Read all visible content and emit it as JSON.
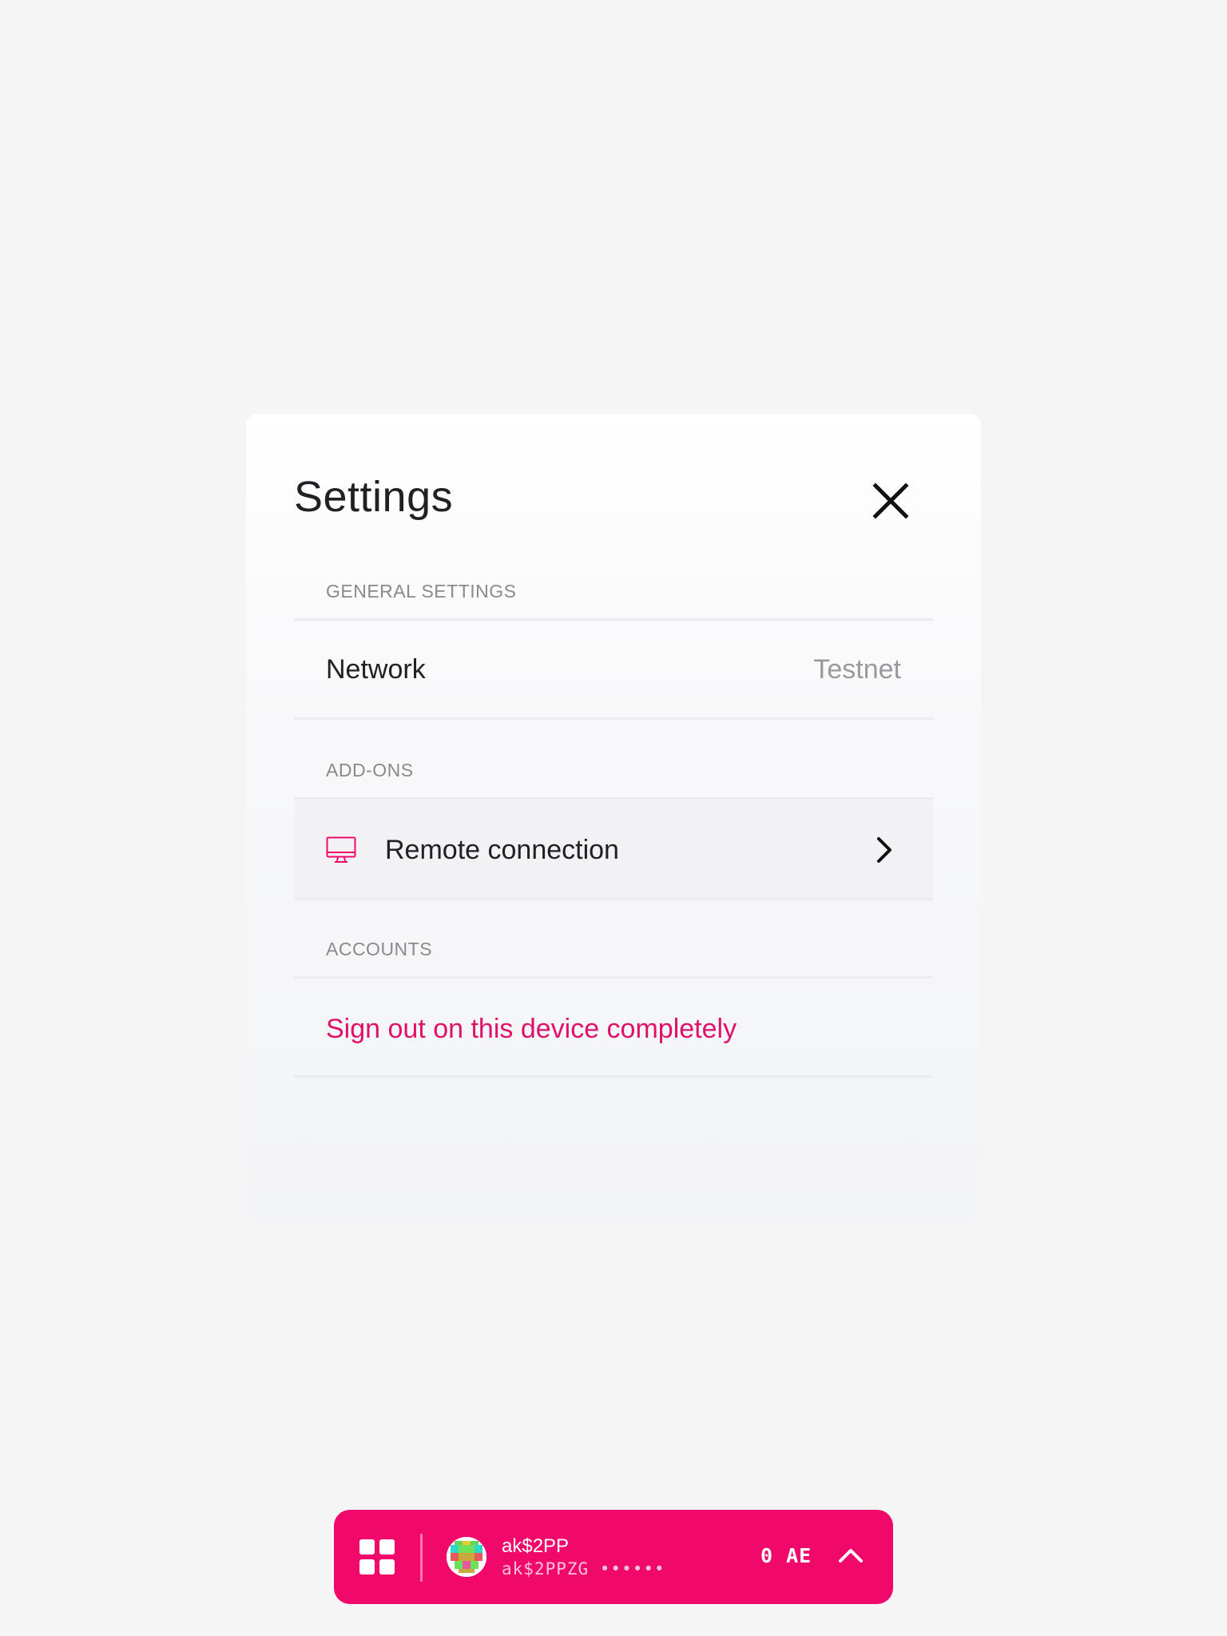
{
  "modal": {
    "title": "Settings",
    "sections": {
      "general": {
        "heading": "GENERAL SETTINGS",
        "network_label": "Network",
        "network_value": "Testnet"
      },
      "addons": {
        "heading": "ADD-ONS",
        "remote_label": "Remote connection"
      },
      "accounts": {
        "heading": "ACCOUNTS",
        "signout_label": "Sign out on this device completely"
      }
    }
  },
  "bottom_bar": {
    "account_name": "ak$2PP",
    "account_address": "ak$2PPZG ••••••",
    "balance": "0 AE"
  },
  "colors": {
    "accent": "#f0096b",
    "danger_text": "#e0116b",
    "background": "#f5f5f5"
  },
  "icons": {
    "close": "close-icon",
    "remote": "monitor-icon",
    "chevron": "chevron-right-icon",
    "menu": "grid-icon",
    "expand": "chevron-up-icon"
  }
}
